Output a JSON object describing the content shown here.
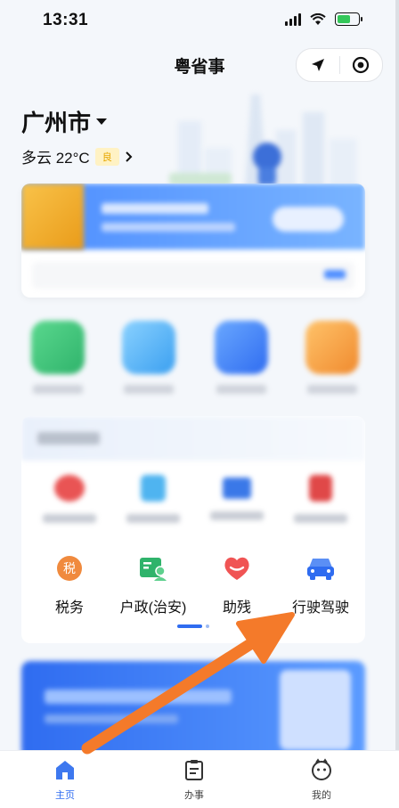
{
  "status_bar": {
    "time": "13:31",
    "icons": [
      "signal-icon",
      "wifi-icon",
      "battery-charging-icon"
    ]
  },
  "header": {
    "title": "粤省事",
    "icons": [
      "location-arrow-icon",
      "target-icon"
    ]
  },
  "location": {
    "city": "广州市",
    "weather": "多云 22°C",
    "air_quality": "良"
  },
  "hot_services": {
    "row2": [
      {
        "label": "税务",
        "icon": "tax-icon",
        "color": "#f08a3e"
      },
      {
        "label": "户政(治安)",
        "icon": "household-id-icon",
        "color": "#2fb36b"
      },
      {
        "label": "助残",
        "icon": "heart-icon",
        "color": "#f05454"
      },
      {
        "label": "行驶驾驶",
        "icon": "car-icon",
        "color": "#2f6cf0"
      }
    ]
  },
  "tabs": [
    {
      "label": "主页",
      "icon": "home-icon",
      "active": true
    },
    {
      "label": "办事",
      "icon": "clipboard-icon",
      "active": false
    },
    {
      "label": "我的",
      "icon": "user-face-icon",
      "active": false
    }
  ],
  "colors": {
    "accent": "#2f6cf0",
    "annotation_arrow": "#f47a2a"
  }
}
